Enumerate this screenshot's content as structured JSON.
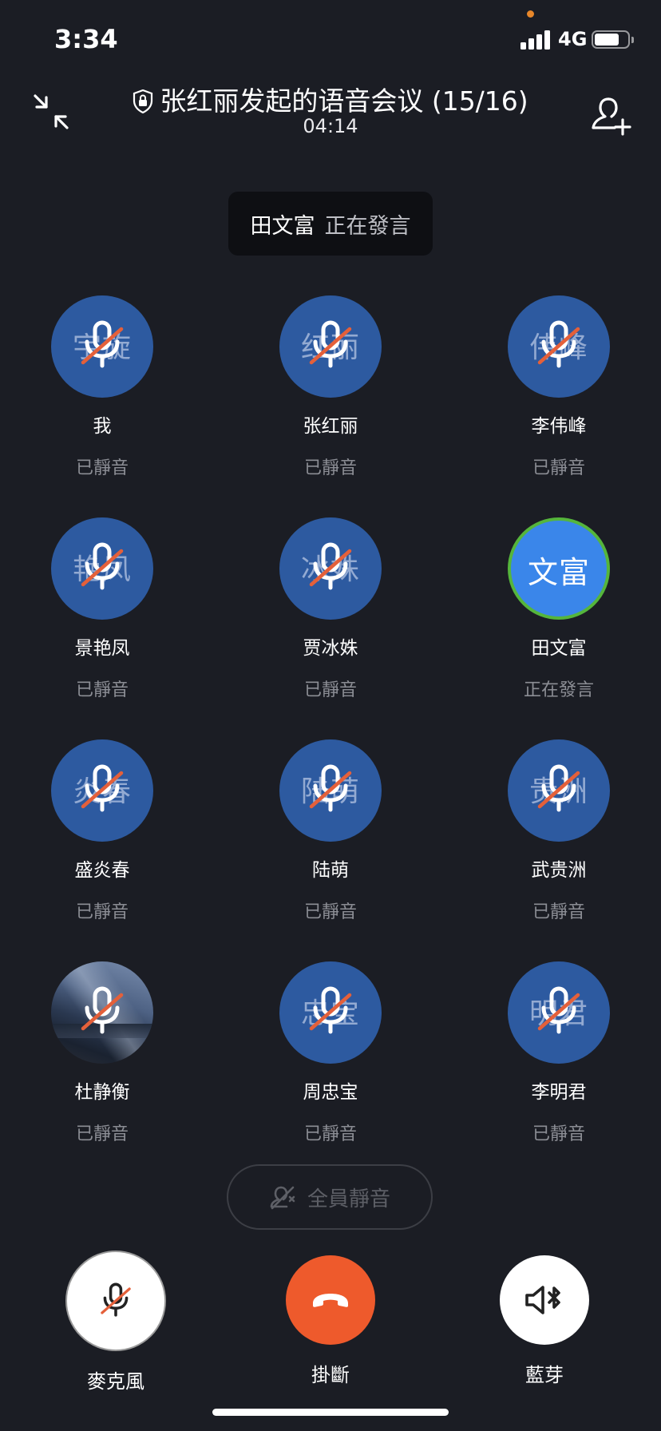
{
  "status_bar": {
    "time": "3:34",
    "network": "4G"
  },
  "header": {
    "title": "张红丽发起的语音会议 (15/16)",
    "timer": "04:14"
  },
  "speaking_banner": {
    "name": "田文富",
    "status": "正在發言"
  },
  "participants": [
    {
      "initials": "宇旋",
      "name": "我",
      "status": "已靜音"
    },
    {
      "initials": "红丽",
      "name": "张红丽",
      "status": "已靜音"
    },
    {
      "initials": "伟峰",
      "name": "李伟峰",
      "status": "已靜音"
    },
    {
      "initials": "艳凤",
      "name": "景艳凤",
      "status": "已靜音"
    },
    {
      "initials": "冰姝",
      "name": "贾冰姝",
      "status": "已靜音"
    },
    {
      "initials": "文富",
      "name": "田文富",
      "status": "正在發言"
    },
    {
      "initials": "炎春",
      "name": "盛炎春",
      "status": "已靜音"
    },
    {
      "initials": "陆萌",
      "name": "陆萌",
      "status": "已靜音"
    },
    {
      "initials": "贵洲",
      "name": "武贵洲",
      "status": "已靜音"
    },
    {
      "initials": "",
      "name": "杜静衡",
      "status": "已靜音"
    },
    {
      "initials": "忠宝",
      "name": "周忠宝",
      "status": "已靜音"
    },
    {
      "initials": "明君",
      "name": "李明君",
      "status": "已靜音"
    }
  ],
  "mute_all": {
    "label": "全員靜音"
  },
  "controls": {
    "microphone": "麥克風",
    "hangup": "掛斷",
    "bluetooth": "藍芽"
  },
  "colors": {
    "background": "#1b1d24",
    "avatar_blue": "#2d5aa0",
    "speaking_blue": "#3a86ea",
    "speaking_ring": "#55b53c",
    "muted_slash": "#e4603a",
    "hangup_red": "#ee5a2c"
  }
}
